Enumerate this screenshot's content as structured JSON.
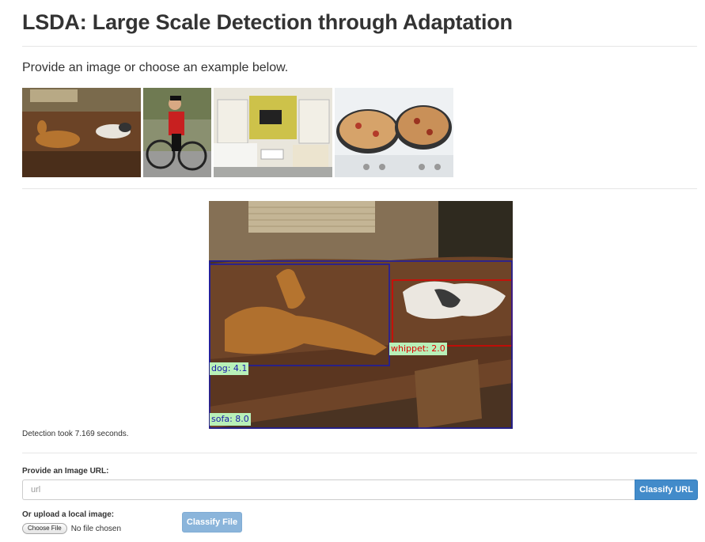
{
  "header": {
    "title": "LSDA: Large Scale Detection through Adaptation"
  },
  "intro": {
    "text": "Provide an image or choose an example below."
  },
  "examples": [
    {
      "name": "dogs-on-sofa"
    },
    {
      "name": "cyclist"
    },
    {
      "name": "living-room"
    },
    {
      "name": "pizzas-on-stove"
    }
  ],
  "result": {
    "detections": [
      {
        "label": "dog: 4.1",
        "color": "#1a1aa8"
      },
      {
        "label": "whippet: 2.0",
        "color": "#e00000"
      },
      {
        "label": "sofa: 8.0",
        "color": "#1a1aa8"
      }
    ],
    "timing": "Detection took 7.169 seconds."
  },
  "url_form": {
    "label": "Provide an Image URL:",
    "placeholder": "url",
    "button": "Classify URL"
  },
  "upload_form": {
    "label": "Or upload a local image:",
    "choose_button": "Choose File",
    "no_file": "No file chosen",
    "button": "Classify File"
  },
  "colors": {
    "primary": "#428bca",
    "primary_disabled": "#8bb5db",
    "label_bg": "#b8f0b8"
  }
}
